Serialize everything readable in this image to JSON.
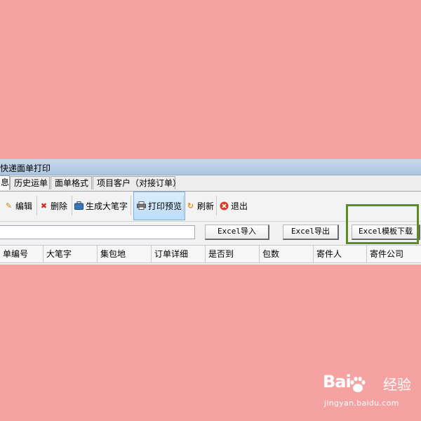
{
  "window": {
    "title": "快递面单打印"
  },
  "tabs": [
    {
      "label": "息"
    },
    {
      "label": "历史运单"
    },
    {
      "label": "面单格式"
    },
    {
      "label": "项目客户（对接订单）"
    }
  ],
  "toolbar": {
    "edit": "编辑",
    "delete": "删除",
    "generate": "生成大笔字",
    "preview": "打印预览",
    "refresh": "刷新",
    "exit": "退出"
  },
  "actions": {
    "search_value": "",
    "import_label": "Excel导入",
    "export_label": "Excel导出",
    "template_label": "Excel模板下载"
  },
  "table": {
    "columns": [
      "单编号",
      "大笔字",
      "集包地",
      "订单详细",
      "是否到",
      "包数",
      "寄件人",
      "寄件公司"
    ]
  },
  "watermark": {
    "brand_a": "Bai",
    "brand_b": "经验",
    "url": "jingyan.baidu.com"
  },
  "colors": {
    "background": "#f4a3a2",
    "highlight_border": "#5a8c1e",
    "selected_button": "#bcdcf7"
  }
}
